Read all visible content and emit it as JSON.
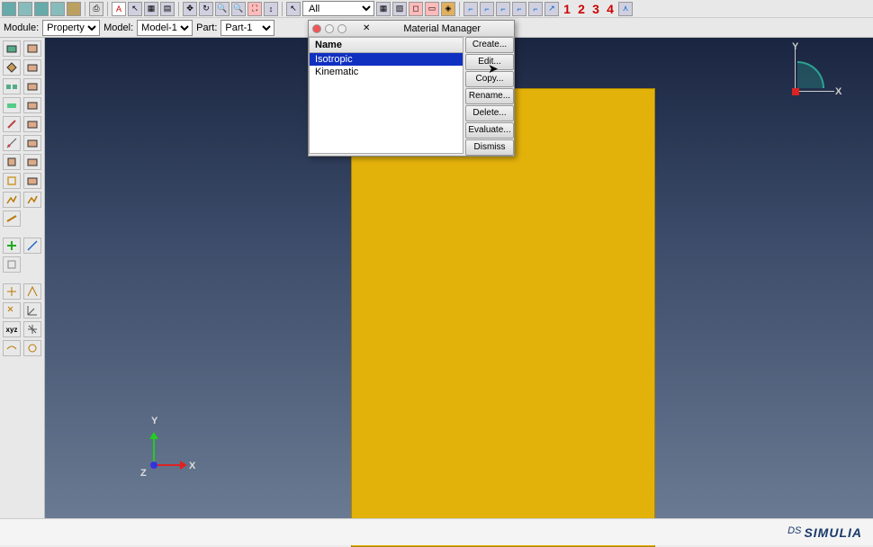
{
  "toolbar": {
    "filter_label": "All",
    "nav_numbers": [
      "1",
      "2",
      "3",
      "4"
    ]
  },
  "context": {
    "module_label": "Module:",
    "module_value": "Property",
    "model_label": "Model:",
    "model_value": "Model-1",
    "part_label": "Part:",
    "part_value": "Part-1"
  },
  "dialog": {
    "title": "Material Manager",
    "list_header": "Name",
    "items": [
      "Isotropic",
      "Kinematic"
    ],
    "selected_index": 0,
    "buttons": {
      "create": "Create...",
      "edit": "Edit...",
      "copy": "Copy...",
      "rename": "Rename...",
      "delete": "Delete...",
      "evaluate": "Evaluate...",
      "dismiss": "Dismiss"
    }
  },
  "triad": {
    "x": "X",
    "y": "Y",
    "z": "Z"
  },
  "status": {
    "brand_prefix": "DS",
    "brand": "SIMULIA"
  }
}
